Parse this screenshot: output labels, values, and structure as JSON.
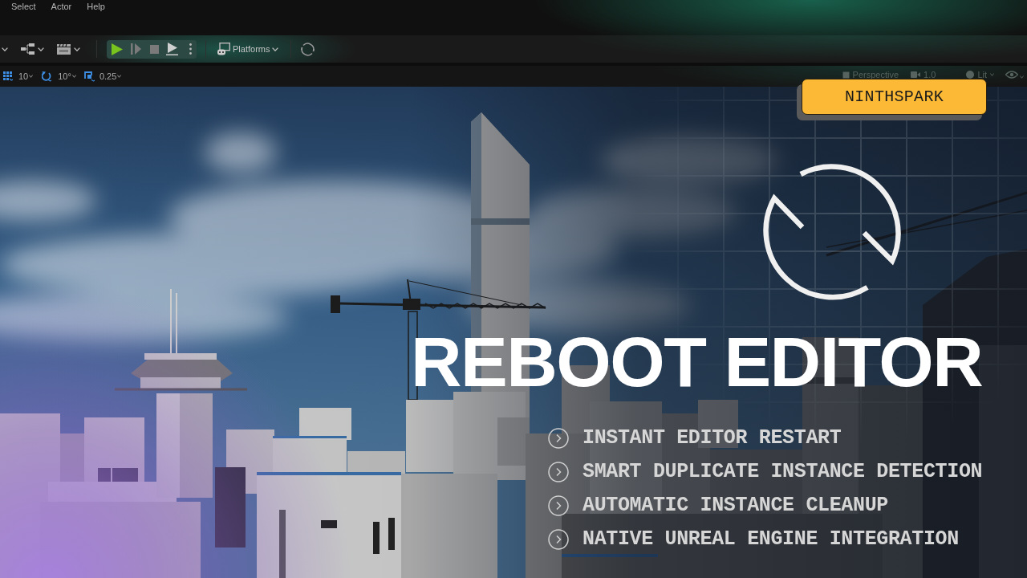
{
  "menu_bar": {
    "items": [
      "Select",
      "Actor",
      "Help"
    ]
  },
  "toolbar": {
    "platforms_button": {
      "label": "Platforms"
    }
  },
  "snap_bar": {
    "items": [
      {
        "value": "10"
      },
      {
        "value": "10°"
      },
      {
        "value": "0.25"
      }
    ]
  },
  "viewport_bar": {
    "items": [
      "Perspective",
      "1.0",
      "Lit"
    ]
  },
  "badge": {
    "label": "NINTHSPARK"
  },
  "title": "REBOOT EDITOR",
  "features": [
    "INSTANT EDITOR RESTART",
    "SMART DUPLICATE INSTANCE DETECTION",
    "AUTOMATIC INSTANCE CLEANUP",
    "NATIVE UNREAL ENGINE INTEGRATION"
  ]
}
